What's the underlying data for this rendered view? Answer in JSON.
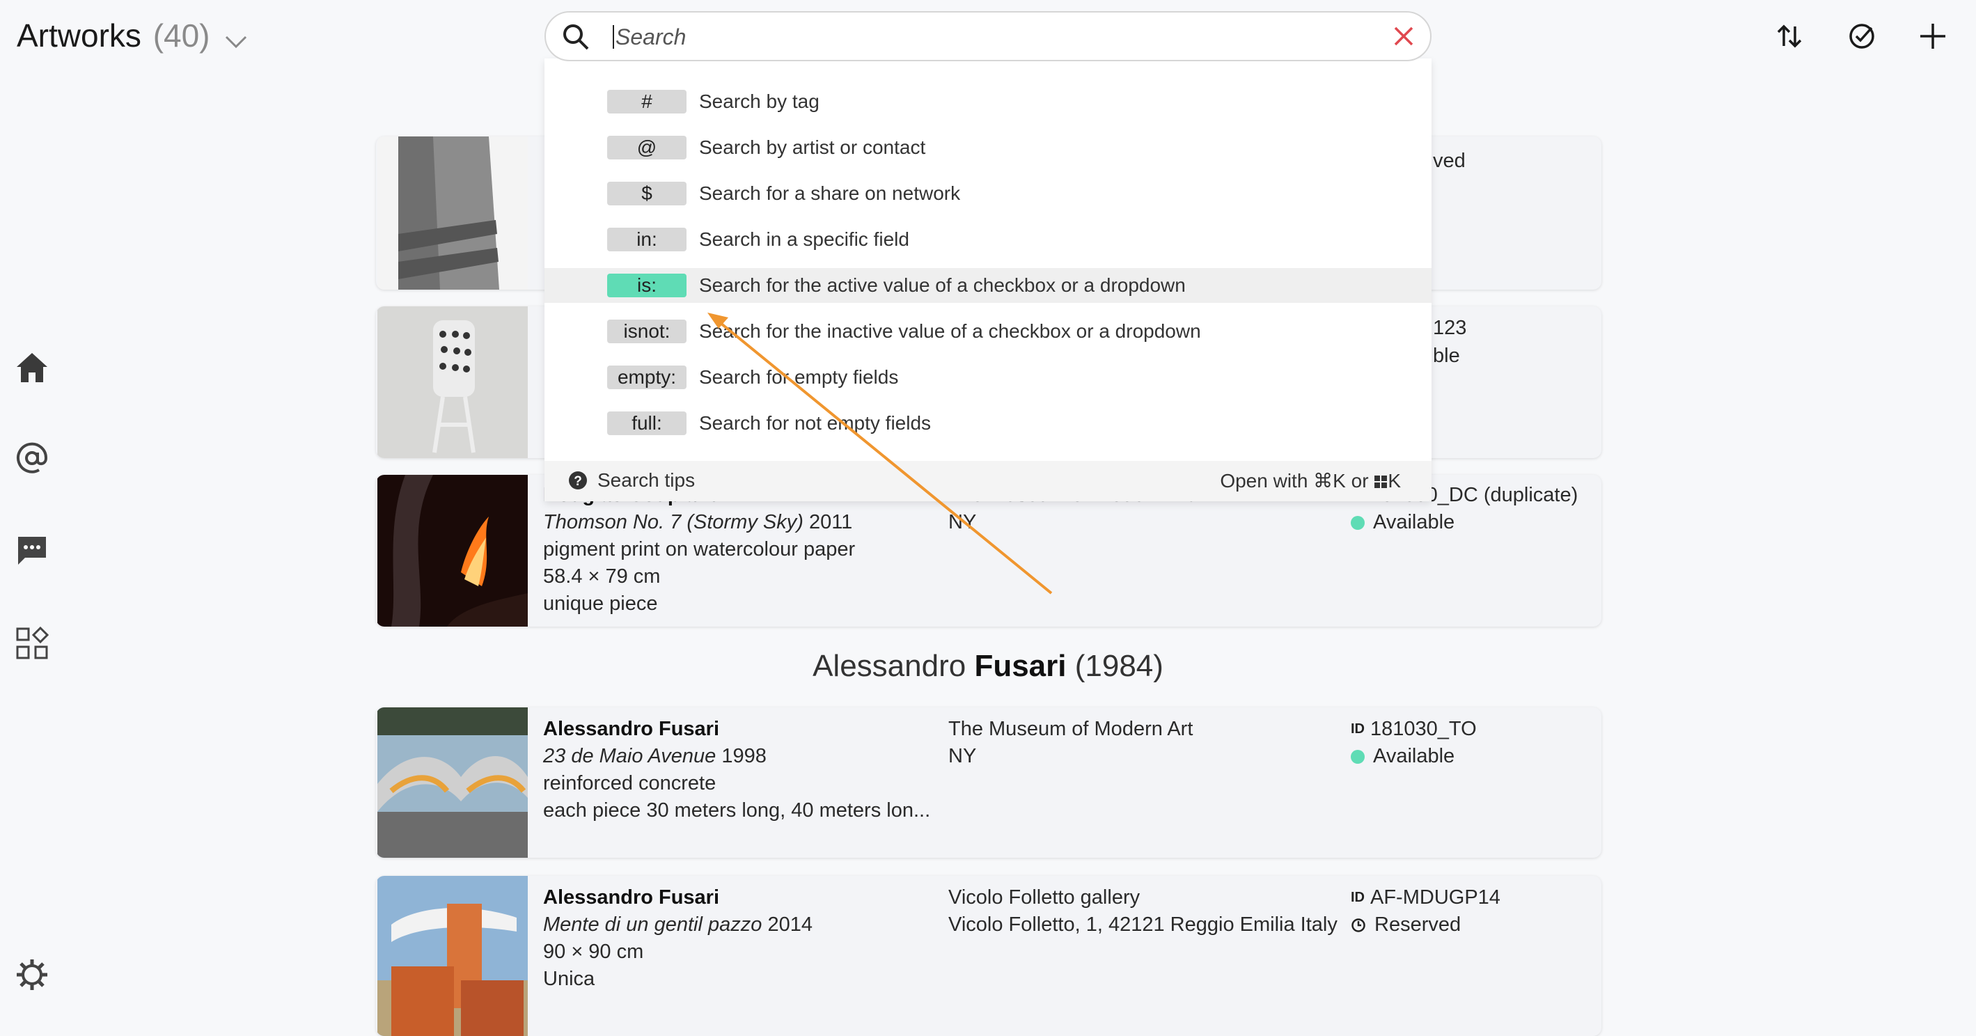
{
  "header": {
    "title": "Artworks",
    "count": "(40)"
  },
  "search": {
    "placeholder": "Search",
    "options": [
      {
        "badge": "#",
        "label": "Search by tag"
      },
      {
        "badge": "@",
        "label": "Search by artist or contact"
      },
      {
        "badge": "$",
        "label": "Search for a share on network"
      },
      {
        "badge": "in:",
        "label": "Search in a specific field"
      },
      {
        "badge": "is:",
        "label": "Search for the active value of a checkbox or a dropdown"
      },
      {
        "badge": "isnot:",
        "label": "Search for the inactive value of a checkbox or a dropdown"
      },
      {
        "badge": "empty:",
        "label": "Search for empty fields"
      },
      {
        "badge": "full:",
        "label": "Search for not empty fields"
      }
    ],
    "tips_label": "Search tips",
    "shortcut": "Open with ⌘K or ",
    "shortcut_key": "K"
  },
  "cards": [
    {
      "partial_status": "ved"
    },
    {
      "partial_id": "123",
      "partial_status": "ble"
    },
    {
      "artist": "Douglas Coupland",
      "title": "Thomson No. 7 (Stormy Sky)",
      "year": "2011",
      "line3": "pigment print on watercolour paper",
      "line4": "58.4 × 79 cm",
      "line5": "unique piece",
      "location1": "The Museum of Modern Art",
      "location2": "NY",
      "id": "181030_DC (duplicate)",
      "status": "Available"
    },
    {
      "artist": "Alessandro Fusari",
      "title": "23 de Maio Avenue",
      "year": "1998",
      "line3": "reinforced concrete",
      "line4": "each piece 30 meters long, 40 meters lon...",
      "location1": "The Museum of Modern Art",
      "location2": "NY",
      "id": "181030_TO",
      "status": "Available"
    },
    {
      "artist": "Alessandro Fusari",
      "title": "Mente di un gentil pazzo",
      "year": "2014",
      "line3": "90 × 90 cm",
      "line4": "Unica",
      "location1": "Vicolo Folletto gallery",
      "location2": "Vicolo Folletto, 1, 42121 Reggio Emilia Italy",
      "id": "AF-MDUGP14",
      "status": "Reserved"
    }
  ],
  "section": {
    "first": "Alessandro",
    "last": "Fusari",
    "years": "(1984)"
  },
  "id_tag": "ID",
  "colors": {
    "accent": "#5fdcb5",
    "annotation_arrow": "#f0962f",
    "clear_icon": "#e0484f"
  }
}
